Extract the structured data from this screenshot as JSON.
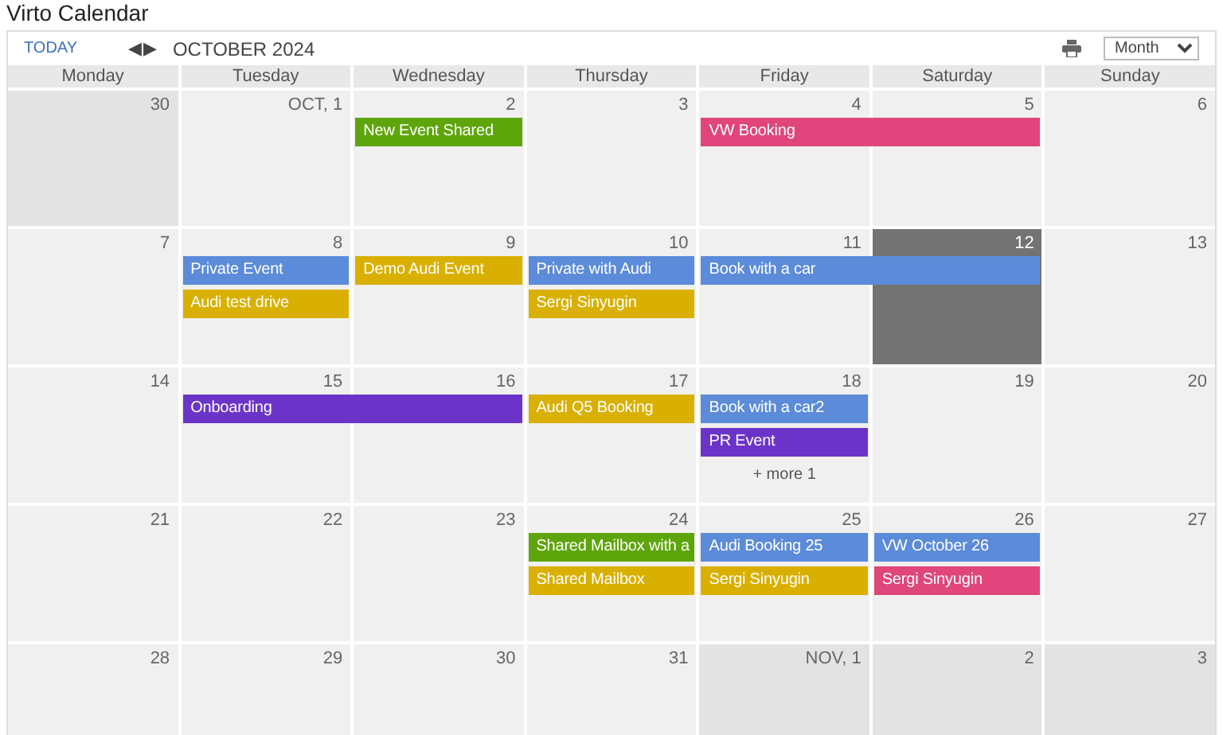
{
  "title": "Virto Calendar",
  "toolbar": {
    "today": "TODAY",
    "prev": "◀",
    "next": "▶",
    "month": "OCTOBER 2024",
    "view": "Month"
  },
  "weekdays": [
    "Monday",
    "Tuesday",
    "Wednesday",
    "Thursday",
    "Friday",
    "Saturday",
    "Sunday"
  ],
  "weeks": [
    {
      "days": [
        {
          "label": "30",
          "kind": "other"
        },
        {
          "label": "OCT, 1",
          "kind": "current"
        },
        {
          "label": "2",
          "kind": "current",
          "events": [
            {
              "title": "New Event Shared",
              "color": "#5ea50b"
            }
          ]
        },
        {
          "label": "3",
          "kind": "current"
        },
        {
          "label": "4",
          "kind": "current",
          "events": [
            {
              "title": "VW Booking",
              "color": "#e0457b"
            }
          ]
        },
        {
          "label": "5",
          "kind": "current",
          "events": [
            {
              "continued": true
            }
          ]
        },
        {
          "label": "6",
          "kind": "current"
        }
      ]
    },
    {
      "days": [
        {
          "label": "7",
          "kind": "current"
        },
        {
          "label": "8",
          "kind": "current",
          "events": [
            {
              "title": "Private Event",
              "color": "#5b8bd9"
            },
            {
              "title": "Audi test drive",
              "color": "#d9b000"
            }
          ]
        },
        {
          "label": "9",
          "kind": "current",
          "events": [
            {
              "title": "Demo Audi Event",
              "color": "#d9b000"
            }
          ]
        },
        {
          "label": "10",
          "kind": "current",
          "events": [
            {
              "title": "Private with Audi",
              "color": "#5b8bd9"
            },
            {
              "title": "Sergi Sinyugin",
              "color": "#d9b000"
            }
          ]
        },
        {
          "label": "11",
          "kind": "current",
          "events": [
            {
              "title": "Book with a car",
              "color": "#5b8bd9"
            }
          ]
        },
        {
          "label": "12",
          "kind": "today",
          "events": [
            {
              "continued": true
            }
          ]
        },
        {
          "label": "13",
          "kind": "current"
        }
      ]
    },
    {
      "days": [
        {
          "label": "14",
          "kind": "current"
        },
        {
          "label": "15",
          "kind": "current",
          "events": [
            {
              "title": "Onboarding",
              "color": "#6b34c9"
            }
          ]
        },
        {
          "label": "16",
          "kind": "current",
          "events": [
            {
              "continued": true
            }
          ]
        },
        {
          "label": "17",
          "kind": "current",
          "events": [
            {
              "title": "Audi Q5 Booking",
              "color": "#d9b000"
            }
          ]
        },
        {
          "label": "18",
          "kind": "current",
          "events": [
            {
              "title": "Book with a car2",
              "color": "#5b8bd9"
            },
            {
              "title": "PR Event",
              "color": "#6b34c9"
            }
          ],
          "more": "+ more 1"
        },
        {
          "label": "19",
          "kind": "current"
        },
        {
          "label": "20",
          "kind": "current"
        }
      ]
    },
    {
      "days": [
        {
          "label": "21",
          "kind": "current"
        },
        {
          "label": "22",
          "kind": "current"
        },
        {
          "label": "23",
          "kind": "current"
        },
        {
          "label": "24",
          "kind": "current",
          "events": [
            {
              "title": "Shared Mailbox with a",
              "color": "#5ea50b"
            },
            {
              "title": "Shared Mailbox",
              "color": "#d9b000"
            }
          ]
        },
        {
          "label": "25",
          "kind": "current",
          "events": [
            {
              "title": "Audi Booking 25",
              "color": "#5b8bd9"
            },
            {
              "title": "Sergi Sinyugin",
              "color": "#d9b000"
            }
          ]
        },
        {
          "label": "26",
          "kind": "current",
          "events": [
            {
              "title": "VW October 26",
              "color": "#5b8bd9"
            },
            {
              "title": "Sergi Sinyugin",
              "color": "#e0457b"
            }
          ]
        },
        {
          "label": "27",
          "kind": "current"
        }
      ]
    },
    {
      "days": [
        {
          "label": "28",
          "kind": "current"
        },
        {
          "label": "29",
          "kind": "current"
        },
        {
          "label": "30",
          "kind": "current"
        },
        {
          "label": "31",
          "kind": "current"
        },
        {
          "label": "NOV, 1",
          "kind": "other"
        },
        {
          "label": "2",
          "kind": "other"
        },
        {
          "label": "3",
          "kind": "other"
        }
      ]
    }
  ]
}
